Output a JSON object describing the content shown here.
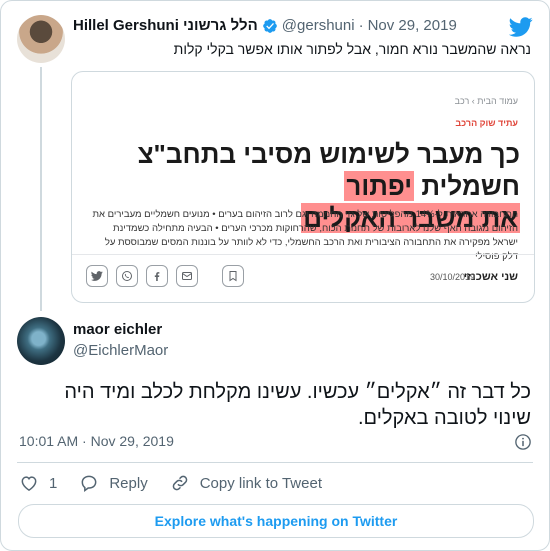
{
  "tweet1": {
    "name": "Hillel Gershuni הלל גרשוני",
    "handle": "@gershuni",
    "date": "Nov 29, 2019",
    "text": "נראה שהמשבר נורא חמור, אבל לפתור אותו אפשר בקלי קלות",
    "verified_icon": "verified-badge-icon",
    "brand_icon": "twitter-bird-icon",
    "colors": {
      "accent": "#1d9bf0",
      "highlight": "#ff8f8f"
    }
  },
  "card": {
    "breadcrumb": "עמוד הבית › רכב",
    "category": "עתיד שוק הרכב",
    "title_plain": "כך מעבר לשימוש מסיבי בתחב\"צ חשמלית ",
    "title_hl1": "יפתור",
    "title_hl2": "את משבר האקלים",
    "body": "התחבורה אחראית ל-14% מהפליטות של גזי החממה וגם לרוב הזיהום בערים • מנועים חשמליים מעבירים את הזיהום מגובה האף שלנו לארובות של תחנות הכוח, שהרחוקות מכרכי הערים • הבעיה מתחילה כשמדינת ישראל מפקירה את התחבורה הציבורית ואת הרכב החשמלי, כדי לא לוותר על בוננות המסים שמבוססת על דלק פוסילי",
    "brand": "שני אשכנזי",
    "date": "30/10/2019",
    "share_icons": [
      "twitter-icon",
      "whatsapp-icon",
      "facebook-icon",
      "mail-icon",
      "bookmark-icon"
    ]
  },
  "tweet2": {
    "name": "maor eichler",
    "handle": "@EichlerMaor",
    "text": "כל דבר זה ״אקלים״ עכשיו. עשינו מקלחת לכלב ומיד היה שינוי לטובה באקלים.",
    "time": "10:01 AM · Nov 29, 2019"
  },
  "actions": {
    "likes": "1",
    "reply": "Reply",
    "copy_link": "Copy link to Tweet"
  },
  "explore_label": "Explore what's happening on Twitter"
}
